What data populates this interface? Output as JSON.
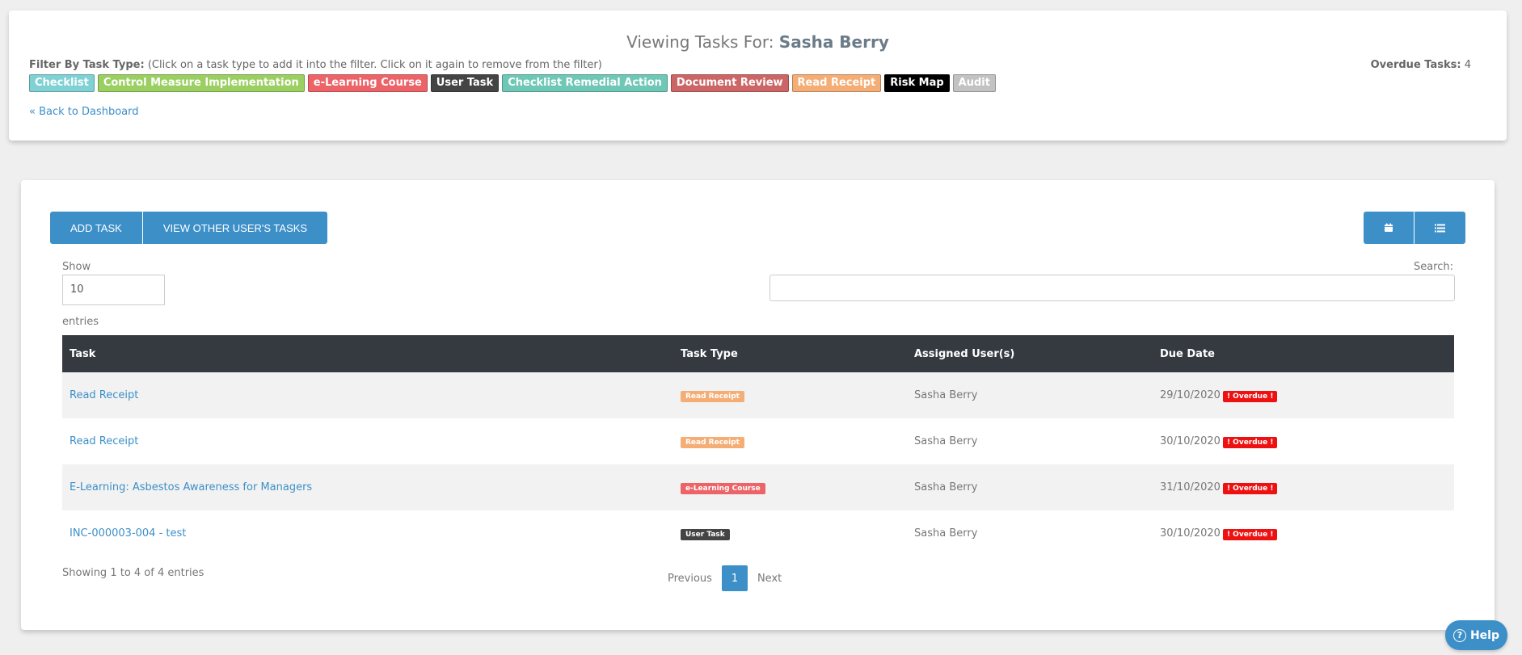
{
  "header": {
    "viewing_prefix": "Viewing Tasks For:",
    "viewing_user": "Sasha Berry",
    "filter_label": "Filter By Task Type:",
    "filter_hint": "(Click on a task type to add it into the filter. Click on it again to remove from the filter)",
    "overdue_label": "Overdue Tasks:",
    "overdue_count": "4",
    "back_link": "« Back to Dashboard"
  },
  "task_types": [
    {
      "label": "Checklist",
      "color": "#7fd1d4"
    },
    {
      "label": "Control Measure Implementation",
      "color": "#9bcf62"
    },
    {
      "label": "e-Learning Course",
      "color": "#ec6468"
    },
    {
      "label": "User Task",
      "color": "#444444"
    },
    {
      "label": "Checklist Remedial Action",
      "color": "#6fc7b5"
    },
    {
      "label": "Document Review",
      "color": "#cc6666"
    },
    {
      "label": "Read Receipt",
      "color": "#f5ad76"
    },
    {
      "label": "Risk Map",
      "color": "#000000"
    },
    {
      "label": "Audit",
      "color": "#c2c2c2"
    }
  ],
  "toolbar": {
    "add_task": "ADD TASK",
    "view_other": "VIEW OTHER USER'S TASKS",
    "calendar_icon": "calendar-icon",
    "list_icon": "list-icon"
  },
  "table_controls": {
    "show_label": "Show",
    "show_value": "10",
    "entries_label": "entries",
    "search_label": "Search:",
    "search_value": ""
  },
  "table": {
    "columns": [
      "Task",
      "Task Type",
      "Assigned User(s)",
      "Due Date"
    ],
    "rows": [
      {
        "task": "Read Receipt",
        "type": "Read Receipt",
        "type_color": "#f5ad76",
        "user": "Sasha Berry",
        "due": "29/10/2020",
        "status": "! Overdue !"
      },
      {
        "task": "Read Receipt",
        "type": "Read Receipt",
        "type_color": "#f5ad76",
        "user": "Sasha Berry",
        "due": "30/10/2020",
        "status": "! Overdue !"
      },
      {
        "task": "E-Learning: Asbestos Awareness for Managers",
        "type": "e-Learning Course",
        "type_color": "#ec6468",
        "user": "Sasha Berry",
        "due": "31/10/2020",
        "status": "! Overdue !"
      },
      {
        "task": "INC-000003-004 - test",
        "type": "User Task",
        "type_color": "#444444",
        "user": "Sasha Berry",
        "due": "30/10/2020",
        "status": "! Overdue !"
      }
    ]
  },
  "footer": {
    "showing": "Showing 1 to 4 of 4 entries",
    "previous": "Previous",
    "page": "1",
    "next": "Next"
  },
  "help": {
    "label": "Help",
    "icon_glyph": "?"
  },
  "colors": {
    "accent": "#3d8fc8",
    "overdue": "#ee1111",
    "table_header": "#353a41"
  }
}
